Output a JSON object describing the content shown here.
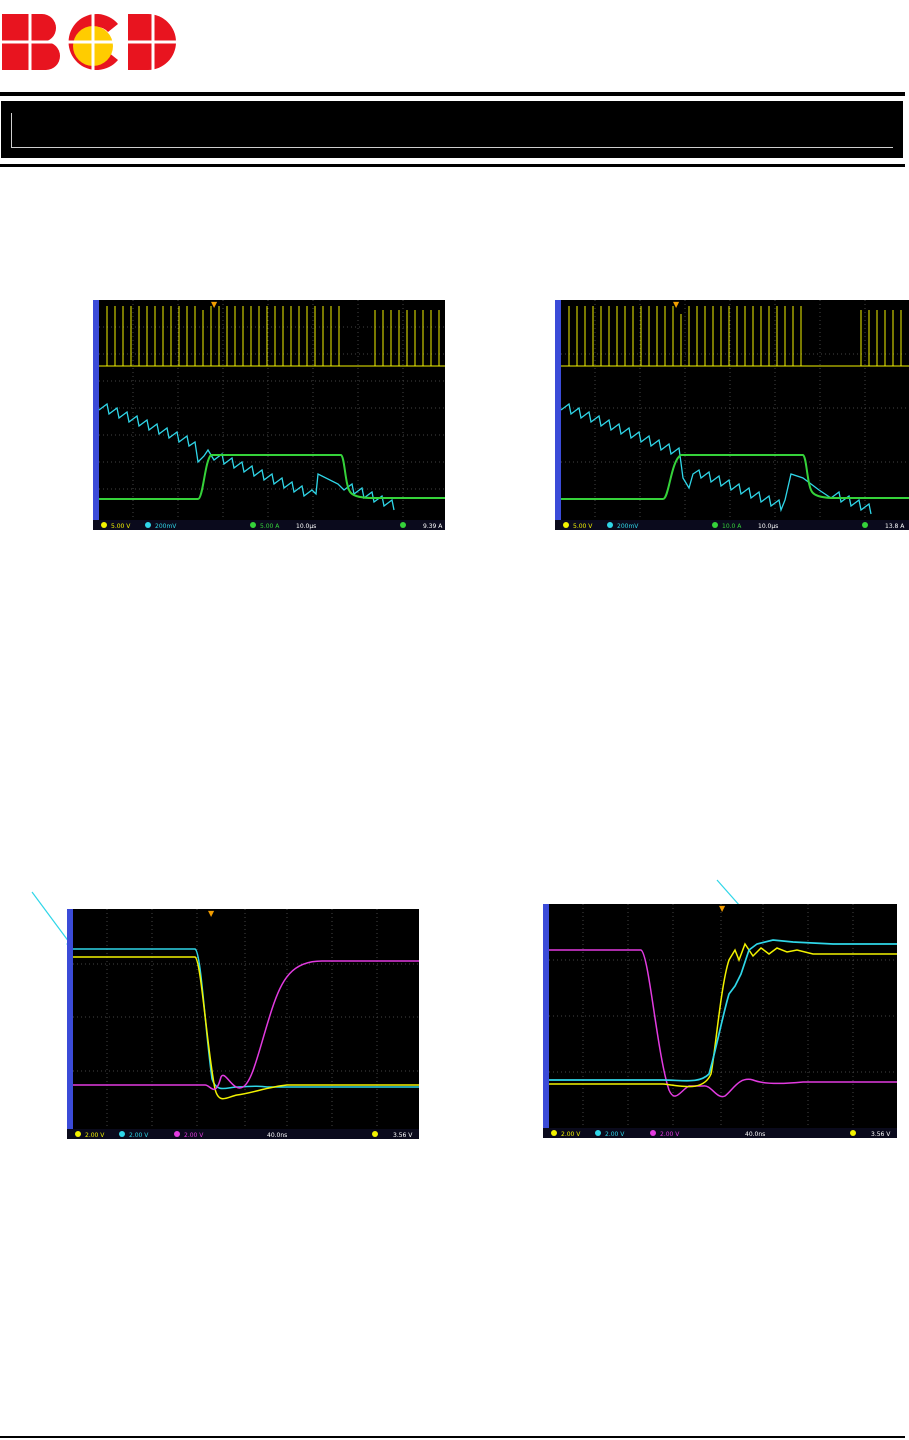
{
  "header": {
    "logo_text": "BCD",
    "colors": {
      "logo_red": "#e8141f",
      "logo_yellow": "#ffcc00",
      "rule": "#000000"
    }
  },
  "scopes": [
    {
      "id": "scope-top-left",
      "ch1_scale": "5.00 V",
      "ch2_scale": "200mV",
      "ch4_scale": "5.00 A",
      "timebase": "10.0µs",
      "trigger": "9.39 A"
    },
    {
      "id": "scope-top-right",
      "ch1_scale": "5.00 V",
      "ch2_scale": "200mV",
      "ch4_scale": "10.0 A",
      "timebase": "10.0µs",
      "trigger": "13.8 A"
    },
    {
      "id": "scope-bottom-left",
      "ch1_scale": "2.00 V",
      "ch2_scale": "2.00 V",
      "ch3_scale": "2.00 V",
      "timebase": "40.0ns",
      "trigger": "3.56 V"
    },
    {
      "id": "scope-bottom-right",
      "ch1_scale": "2.00 V",
      "ch2_scale": "2.00 V",
      "ch3_scale": "2.00 V",
      "timebase": "40.0ns",
      "trigger": "3.56 V"
    }
  ],
  "trace_colors": {
    "ch1": "#f2f200",
    "ch2": "#2fd6e8",
    "ch3": "#e23be0",
    "ch4": "#35d23a"
  }
}
